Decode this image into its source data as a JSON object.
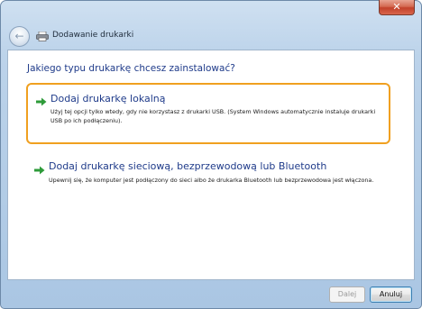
{
  "window": {
    "title": "Dodawanie drukarki",
    "close_label": "✕"
  },
  "header": {
    "back_label": "←"
  },
  "main": {
    "question": "Jakiego typu drukarkę chcesz zainstalować?",
    "options": [
      {
        "title": "Dodaj drukarkę lokalną",
        "description": "Użyj tej opcji tylko wtedy, gdy nie korzystasz z drukarki USB. (System Windows automatycznie instaluje drukarki USB po ich podłączeniu)."
      },
      {
        "title": "Dodaj drukarkę sieciową, bezprzewodową lub Bluetooth",
        "description": "Upewnij się, że komputer jest podłączony do sieci albo że drukarka Bluetooth lub bezprzewodowa jest włączona."
      }
    ]
  },
  "footer": {
    "next_label": "Dalej",
    "cancel_label": "Anuluj"
  },
  "colors": {
    "accent_orange": "#f0a020",
    "link_blue": "#1f3b8a",
    "arrow_green": "#2e9b3a"
  }
}
